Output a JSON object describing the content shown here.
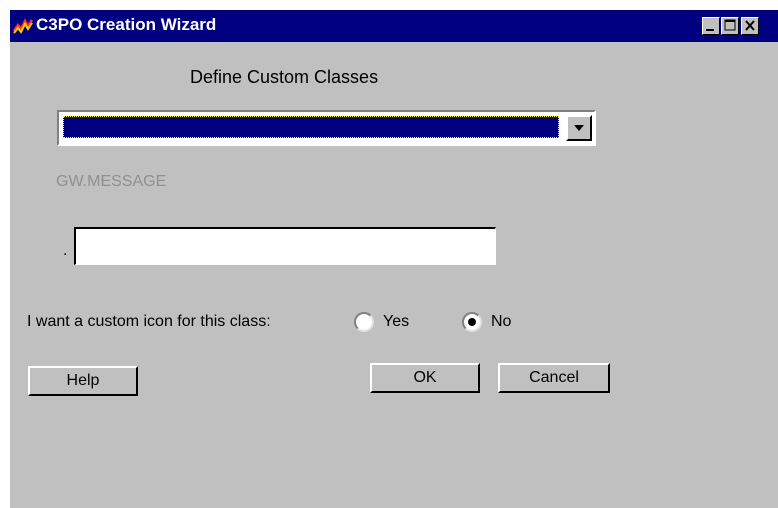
{
  "window": {
    "title": "C3PO Creation Wizard"
  },
  "dialog": {
    "heading": "Define Custom Classes",
    "class_dropdown": {
      "selected": ""
    },
    "parent_class_label": "GW.MESSAGE",
    "separator": ".",
    "class_name_input": {
      "value": ""
    },
    "custom_icon_question": "I want a custom icon for this class:",
    "custom_icon_options": [
      {
        "label": "Yes",
        "selected": false
      },
      {
        "label": "No",
        "selected": true
      }
    ],
    "buttons": {
      "help": "Help",
      "ok": "OK",
      "cancel": "Cancel"
    }
  },
  "colors": {
    "titlebar": "#000080",
    "dialog_bg": "#c0c0c0",
    "dropdown_selection": "#000080",
    "disabled_text": "#909090"
  },
  "icons": {
    "app": "zigzag-lightning-icon",
    "minimize": "minimize-icon",
    "maximize": "maximize-icon",
    "close": "close-icon",
    "dropdown": "chevron-down-icon"
  }
}
